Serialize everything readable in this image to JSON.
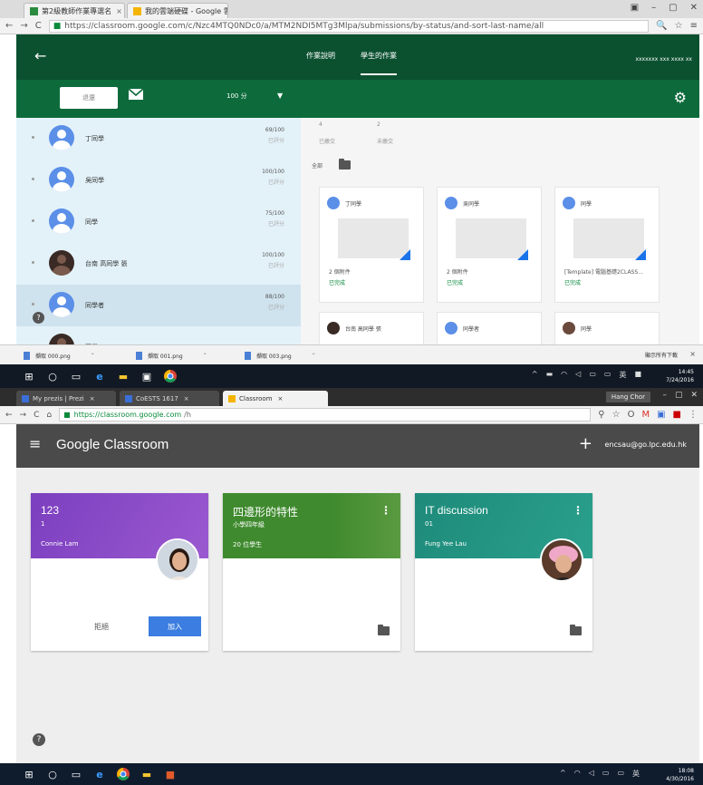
{
  "top": {
    "browser": {
      "tabs": [
        {
          "label": "第2級教師作業專選名"
        },
        {
          "label": "我的雲端硬碟 - Google 雲"
        }
      ],
      "url": "https://classroom.google.com/c/Nzc4MTQ0NDc0/a/MTM2NDI5MTg3Mlpa/submissions/by-status/and-sort-last-name/all"
    },
    "header": {
      "tab_instructions": "作業說明",
      "tab_student_work": "學生的作業",
      "account": "xxxxxxx xxx xxxx xx",
      "return_button": "退還",
      "points": "100 分"
    },
    "students": [
      {
        "name": "丁同學",
        "score": "69/100",
        "status": "已評分"
      },
      {
        "name": "吳同學",
        "score": "100/100",
        "status": "已評分"
      },
      {
        "name": "同學",
        "score": "75/100",
        "status": "已評分"
      },
      {
        "name": "台南 高同學 張",
        "score": "100/100",
        "status": "已評分"
      },
      {
        "name": "同學者",
        "score": "88/100",
        "status": "已評分"
      },
      {
        "name": "同學",
        "score": "",
        "status": ""
      }
    ],
    "stats": [
      {
        "num": "4",
        "label": "已繳交"
      },
      {
        "num": "2",
        "label": "未繳交"
      }
    ],
    "all_label": "全部",
    "submissions": [
      {
        "name": "丁同學",
        "count": "2 個附件",
        "status": "已完成"
      },
      {
        "name": "吳同學",
        "count": "2 個附件",
        "status": "已完成"
      },
      {
        "name": "同學",
        "count": "[Template] 電腦基礎2CLASS...",
        "status": "已完成"
      },
      {
        "name": "台南 高同學 張",
        "count": "",
        "status": ""
      },
      {
        "name": "同學者",
        "count": "",
        "status": ""
      },
      {
        "name": "同學",
        "count": "",
        "status": ""
      }
    ],
    "help": "?",
    "downloads": [
      {
        "name": "擷取 000.png"
      },
      {
        "name": "擷取 001.png"
      },
      {
        "name": "擷取 003.png"
      }
    ],
    "show_all": "顯示所有下載",
    "clock": {
      "time": "14:45",
      "date": "7/24/2016"
    }
  },
  "bottom": {
    "browser": {
      "tabs": [
        {
          "label": "My prezis | Prezi"
        },
        {
          "label": "CoESTS 1617"
        },
        {
          "label": "Classroom"
        }
      ],
      "user": "Hang Chor",
      "url_host": "https://classroom.google.com",
      "url_rest": "/h"
    },
    "app": {
      "brand": "Google Classroom",
      "plus": "+",
      "email": "encsau@go.lpc.edu.hk"
    },
    "classes": [
      {
        "title": "123",
        "section": "1",
        "teacher": "Connie Lam",
        "color": "#7b3fbf",
        "decline": "拒絕",
        "join": "加入"
      },
      {
        "title": "四邊形的特性",
        "section": "小學四年級",
        "teacher": "20 位學生",
        "color": "#3f8a2e"
      },
      {
        "title": "IT discussion",
        "section": "01",
        "teacher": "Fung Yee Lau",
        "color": "#1e8a7a"
      }
    ],
    "help": "?",
    "clock": {
      "time": "18:08",
      "date": "4/30/2016"
    }
  }
}
